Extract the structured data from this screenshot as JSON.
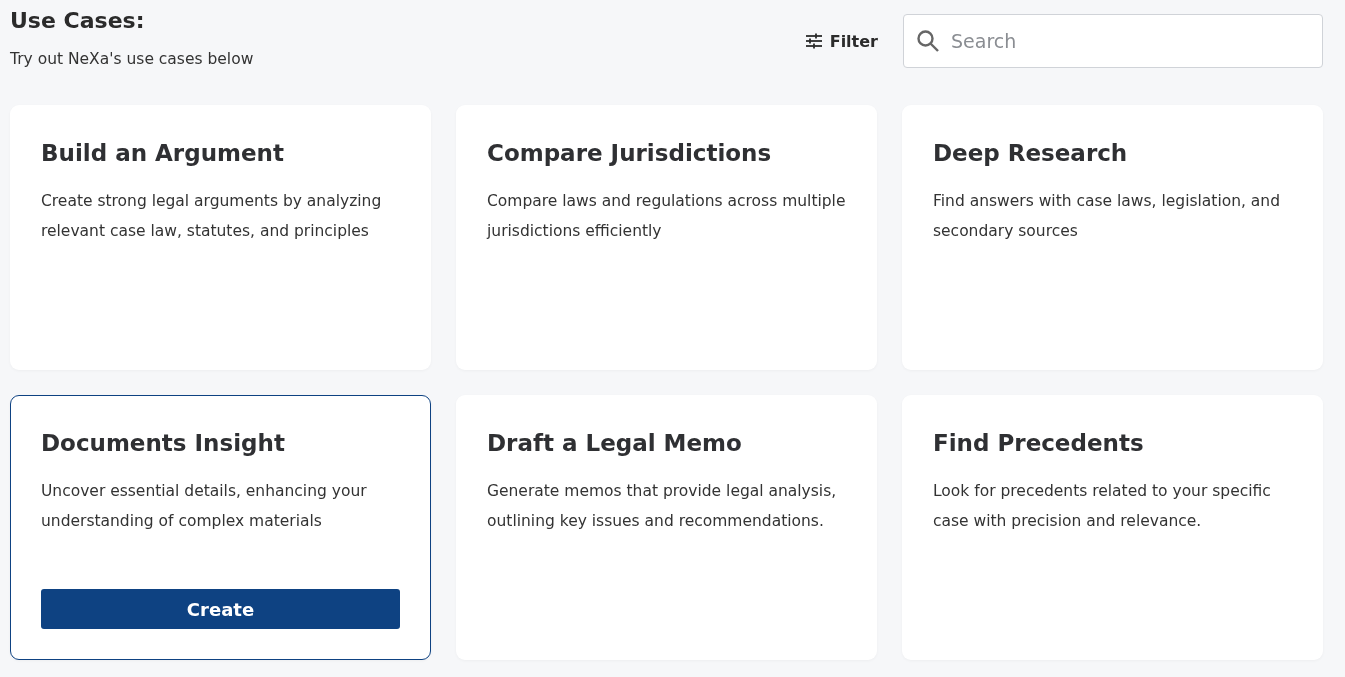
{
  "header": {
    "title": "Use Cases:",
    "subtitle": "Try out NeXa's use cases below"
  },
  "filter": {
    "label": "Filter"
  },
  "search": {
    "placeholder": "Search"
  },
  "cards": [
    {
      "title": "Build an Argument",
      "description": "Create strong legal arguments by analyzing relevant case law, statutes, and principles",
      "selected": false
    },
    {
      "title": "Compare Jurisdictions",
      "description": "Compare laws and regulations across multiple jurisdictions efficiently",
      "selected": false
    },
    {
      "title": "Deep Research",
      "description": "Find answers with case laws, legislation, and secondary sources",
      "selected": false
    },
    {
      "title": "Documents Insight",
      "description": "Uncover essential details, enhancing your understanding of complex materials",
      "selected": true
    },
    {
      "title": "Draft a Legal Memo",
      "description": "Generate memos that provide legal analysis, outlining key issues and recommendations.",
      "selected": false
    },
    {
      "title": "Find Precedents",
      "description": "Look for precedents related to your specific case with precision and relevance.",
      "selected": false
    }
  ],
  "create_button": {
    "label": "Create"
  }
}
